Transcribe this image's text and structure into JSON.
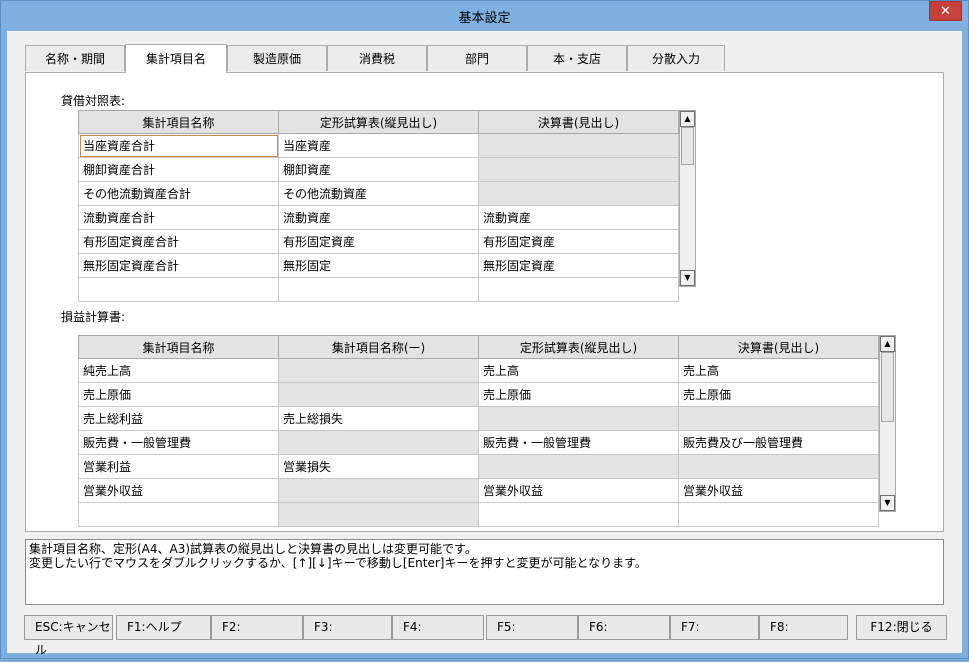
{
  "window": {
    "title": "基本設定",
    "close_label": "✕"
  },
  "tabs": [
    "名称・期間",
    "集計項目名",
    "製造原価",
    "消費税",
    "部門",
    "本・支店",
    "分散入力"
  ],
  "balance_sheet": {
    "label": "貸借対照表:",
    "columns": [
      "集計項目名称",
      "定形試算表(縦見出し)",
      "決算書(見出し)"
    ],
    "rows": [
      [
        "当座資産合計",
        "当座資産",
        ""
      ],
      [
        "棚卸資産合計",
        "棚卸資産",
        ""
      ],
      [
        "その他流動資産合計",
        "その他流動資産",
        ""
      ],
      [
        "流動資産合計",
        "流動資産",
        "流動資産"
      ],
      [
        "有形固定資産合計",
        "有形固定資産",
        "有形固定資産"
      ],
      [
        "無形固定資産合計",
        "無形固定",
        "無形固定資産"
      ]
    ]
  },
  "income_statement": {
    "label": "損益計算書:",
    "columns": [
      "集計項目名称",
      "集計項目名称(ー)",
      "定形試算表(縦見出し)",
      "決算書(見出し)"
    ],
    "rows": [
      [
        "純売上高",
        "",
        "売上高",
        "売上高"
      ],
      [
        "売上原価",
        "",
        "売上原価",
        "売上原価"
      ],
      [
        "売上総利益",
        "売上総損失",
        "",
        ""
      ],
      [
        "販売費・一般管理費",
        "",
        "販売費・一般管理費",
        "販売費及び一般管理費"
      ],
      [
        "営業利益",
        "営業損失",
        "",
        ""
      ],
      [
        "営業外収益",
        "",
        "営業外収益",
        "営業外収益"
      ]
    ]
  },
  "message": "集計項目名称、定形(A4、A3)試算表の縦見出しと決算書の見出しは変更可能です。\n変更したい行でマウスをダブルクリックするか、[↑][↓]キーで移動し[Enter]キーを押すと変更が可能となります。",
  "function_keys": [
    "ESC:キャンセル",
    "F1:ヘルプ",
    "F2:",
    "F3:",
    "F4:",
    "F5:",
    "F6:",
    "F7:",
    "F8:",
    "F12:閉じる"
  ]
}
